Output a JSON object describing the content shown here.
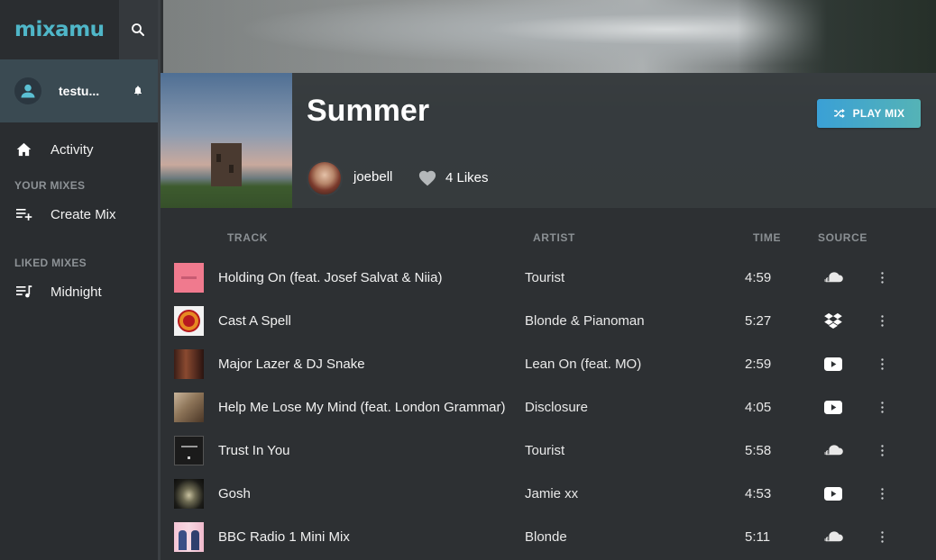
{
  "app": {
    "logo": "mixamu"
  },
  "user": {
    "name": "testu..."
  },
  "nav": {
    "activity_label": "Activity"
  },
  "your_mixes": {
    "title": "YOUR MIXES",
    "items": [
      {
        "label": "Create Mix",
        "icon": "playlist-add-icon"
      }
    ]
  },
  "liked_mixes": {
    "title": "LIKED MIXES",
    "items": [
      {
        "label": "Midnight",
        "icon": "queue-music-icon"
      }
    ]
  },
  "mix": {
    "title": "Summer",
    "owner": "joebell",
    "likes": "4 Likes",
    "play_label": "PLAY MIX",
    "accent_from": "#3aa0d6",
    "accent_to": "#55b3b6"
  },
  "table": {
    "headers": {
      "track": "TRACK",
      "artist": "ARTIST",
      "time": "TIME",
      "source": "SOURCE"
    },
    "rows": [
      {
        "track": "Holding On (feat. Josef Salvat & Niia)",
        "artist": "Tourist",
        "time": "4:59",
        "source": "soundcloud"
      },
      {
        "track": "Cast A Spell",
        "artist": "Blonde & Pianoman",
        "time": "5:27",
        "source": "dropbox"
      },
      {
        "track": "Major Lazer & DJ Snake",
        "artist": "Lean On (feat. MO)",
        "time": "2:59",
        "source": "youtube"
      },
      {
        "track": "Help Me Lose My Mind (feat. London Grammar)",
        "artist": "Disclosure",
        "time": "4:05",
        "source": "youtube"
      },
      {
        "track": "Trust In You",
        "artist": "Tourist",
        "time": "5:58",
        "source": "soundcloud"
      },
      {
        "track": "Gosh",
        "artist": "Jamie xx",
        "time": "4:53",
        "source": "youtube"
      },
      {
        "track": "BBC Radio 1 Mini Mix",
        "artist": "Blonde",
        "time": "5:11",
        "source": "soundcloud"
      }
    ]
  }
}
